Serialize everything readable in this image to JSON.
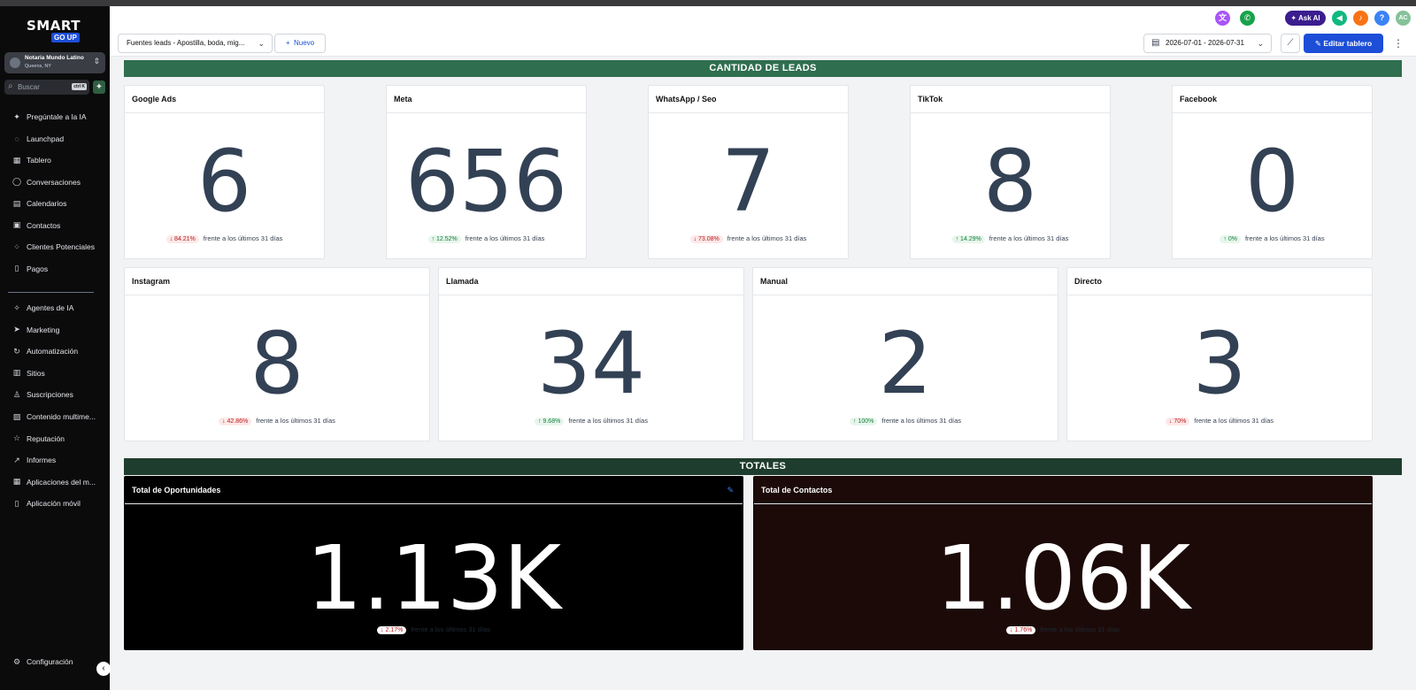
{
  "sidebar": {
    "logo_top": "SMART",
    "logo_bottom": "GO UP",
    "account": {
      "name": "Notaria Mundo Latino",
      "location": "Queens, NY"
    },
    "search": {
      "placeholder": "Buscar",
      "shortcut": "ctrl K"
    },
    "items": [
      {
        "label": "Pregúntale a la IA",
        "icon": "sparkle-icon",
        "glyph": "✦"
      },
      {
        "label": "Launchpad",
        "icon": "rocket-icon",
        "glyph": "◌"
      },
      {
        "label": "Tablero",
        "icon": "dashboard-icon",
        "glyph": "▦"
      },
      {
        "label": "Conversaciones",
        "icon": "chat-icon",
        "glyph": "◯"
      },
      {
        "label": "Calendarios",
        "icon": "calendar-icon",
        "glyph": "▤"
      },
      {
        "label": "Contactos",
        "icon": "contacts-icon",
        "glyph": "▣"
      },
      {
        "label": "Clientes Potenciales",
        "icon": "leads-icon",
        "glyph": "⁘"
      },
      {
        "label": "Pagos",
        "icon": "payments-icon",
        "glyph": "▯"
      }
    ],
    "items2": [
      {
        "label": "Agentes de IA",
        "icon": "ai-agents-icon",
        "glyph": "✧"
      },
      {
        "label": "Marketing",
        "icon": "send-icon",
        "glyph": "➤"
      },
      {
        "label": "Automatización",
        "icon": "automation-icon",
        "glyph": "↻"
      },
      {
        "label": "Sitios",
        "icon": "sites-icon",
        "glyph": "▥"
      },
      {
        "label": "Suscripciones",
        "icon": "subscriptions-icon",
        "glyph": "♙"
      },
      {
        "label": "Contenido multime...",
        "icon": "media-icon",
        "glyph": "▨"
      },
      {
        "label": "Reputación",
        "icon": "star-icon",
        "glyph": "☆"
      },
      {
        "label": "Informes",
        "icon": "reports-icon",
        "glyph": "↗"
      },
      {
        "label": "Aplicaciones del m...",
        "icon": "apps-icon",
        "glyph": "▦"
      },
      {
        "label": "Aplicación móvil",
        "icon": "mobile-icon",
        "glyph": "▯"
      }
    ],
    "settings": {
      "label": "Configuración",
      "icon": "gear-icon",
      "glyph": "⚙"
    }
  },
  "header": {
    "ask_ai": "Ask AI",
    "avatar": "AC",
    "colors": {
      "translate": "#a855f7",
      "phone": "#16a34a",
      "megaphone": "#10b981",
      "bell": "#f97316",
      "help": "#3b82f6",
      "avatar": "#86c29a"
    }
  },
  "toolbar": {
    "source_filter": "Fuentes leads - Apostilla, boda, mig...",
    "new_label": "Nuevo",
    "date_range": "2026-07-01 - 2026-07-31",
    "edit_label": "Editar tablero"
  },
  "section1": {
    "title": "CANTIDAD DE LEADS",
    "color": "#2f6e4e"
  },
  "section2": {
    "title": "TOTALES",
    "color": "#1f3d2e"
  },
  "compare_text": "frente a los últimos 31 días",
  "cards_row1": [
    {
      "title": "Google Ads",
      "value": "6",
      "change": "84.21%",
      "dir": "down"
    },
    {
      "title": "Meta",
      "value": "656",
      "change": "12.52%",
      "dir": "up"
    },
    {
      "title": "WhatsApp / Seo",
      "value": "7",
      "change": "73.08%",
      "dir": "down"
    },
    {
      "title": "TikTok",
      "value": "8",
      "change": "14.29%",
      "dir": "up"
    },
    {
      "title": "Facebook",
      "value": "0",
      "change": "0%",
      "dir": "up"
    }
  ],
  "cards_row2": [
    {
      "title": "Instagram",
      "value": "8",
      "change": "42.86%",
      "dir": "down"
    },
    {
      "title": "Llamada",
      "value": "34",
      "change": "9.68%",
      "dir": "up"
    },
    {
      "title": "Manual",
      "value": "2",
      "change": "100%",
      "dir": "up"
    },
    {
      "title": "Directo",
      "value": "3",
      "change": "70%",
      "dir": "down"
    }
  ],
  "totals": [
    {
      "title": "Total de Oportunidades",
      "value": "1.13K",
      "change": "2.17%",
      "dir": "down",
      "bg": "#000000"
    },
    {
      "title": "Total de Contactos",
      "value": "1.06K",
      "change": "1.76%",
      "dir": "down",
      "bg": "#1c0a08"
    }
  ]
}
